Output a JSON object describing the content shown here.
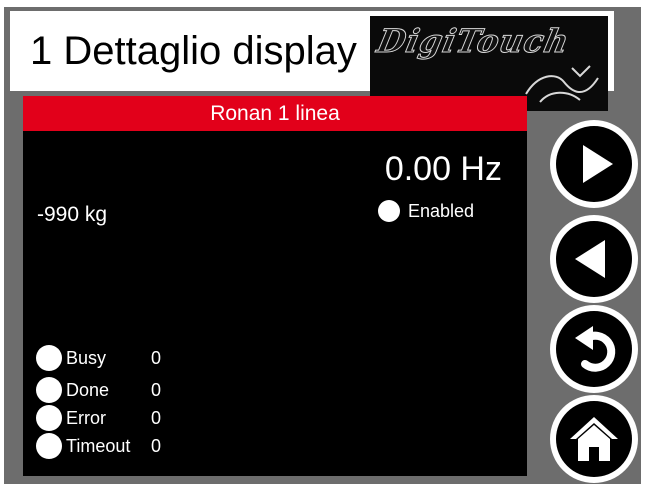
{
  "header": {
    "title": "1 Dettaglio display",
    "logo_text": "DigiTouch"
  },
  "panel": {
    "line_name": "Ronan 1 linea",
    "frequency": "0.00 Hz",
    "enabled_label": "Enabled",
    "weight": "-990 kg"
  },
  "status": [
    {
      "label": "Busy",
      "value": "0"
    },
    {
      "label": "Done",
      "value": "0"
    },
    {
      "label": "Error",
      "value": "0"
    },
    {
      "label": "Timeout",
      "value": "0"
    }
  ],
  "nav": [
    {
      "name": "next",
      "icon": "play-right-icon"
    },
    {
      "name": "previous",
      "icon": "play-left-icon"
    },
    {
      "name": "back",
      "icon": "undo-arrow-icon"
    },
    {
      "name": "home",
      "icon": "home-icon"
    }
  ],
  "colors": {
    "frame": "#6d6d6d",
    "header_red": "#e2001a",
    "panel": "#000000",
    "indicator": "#ffffff"
  }
}
